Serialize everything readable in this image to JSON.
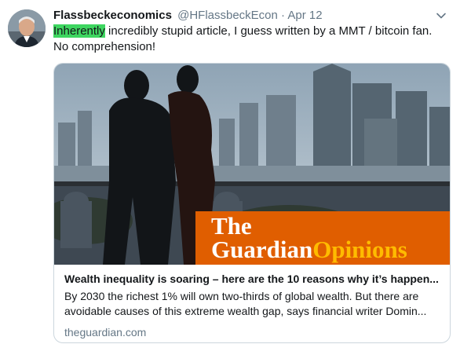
{
  "tweet": {
    "display_name": "Flassbeckeconomics",
    "handle": "@HFlassbeckEcon",
    "separator": "·",
    "timestamp": "Apr 12",
    "text_highlighted": "Inherently",
    "text_line1_rest": " incredibly stupid article, I guess written by a MMT / bitcoin fan.",
    "text_line2": "No comprehension!",
    "highlight_color": "#3ed660"
  },
  "card": {
    "image_brand_the": "The",
    "image_brand_guardian": "Guardian",
    "image_brand_opinions": "Opinions",
    "brand_color": "#e05e00",
    "title": "Wealth inequality is soaring – here are the 10 reasons why it’s happen...",
    "description_line1": "By 2030 the richest 1% will own two-thirds of global wealth. But there are",
    "description_line2": "avoidable causes of this extreme wealth gap, says financial writer Domin...",
    "domain": "theguardian.com"
  },
  "icons": {
    "caret": "chevron-down-icon"
  }
}
